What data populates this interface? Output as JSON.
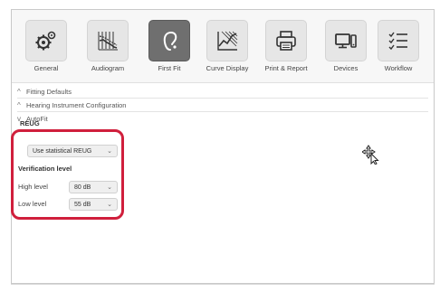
{
  "toolbar": {
    "items": [
      {
        "label": "General",
        "icon": "gear-icon"
      },
      {
        "label": "Audiogram",
        "icon": "audiogram-icon"
      },
      {
        "label": "First Fit",
        "icon": "hearing-aid-icon"
      },
      {
        "label": "Curve Display",
        "icon": "curve-chart-icon"
      },
      {
        "label": "Print & Report",
        "icon": "printer-icon"
      },
      {
        "label": "Devices",
        "icon": "devices-icon"
      },
      {
        "label": "Workflow",
        "icon": "checklist-icon"
      }
    ],
    "active_index": 2
  },
  "sections": {
    "fitting_defaults": "Fitting Defaults",
    "hearing_instrument": "Hearing Instrument Configuration",
    "autofit": "AutoFit"
  },
  "autofit": {
    "reug_label": "REUG",
    "reug_select": "Use statistical REUG",
    "verification_title": "Verification level",
    "high_label": "High level",
    "high_value": "80 dB",
    "low_label": "Low level",
    "low_value": "55 dB"
  },
  "colors": {
    "highlight": "#d01f3c",
    "active_tile": "#6f6f6f"
  }
}
